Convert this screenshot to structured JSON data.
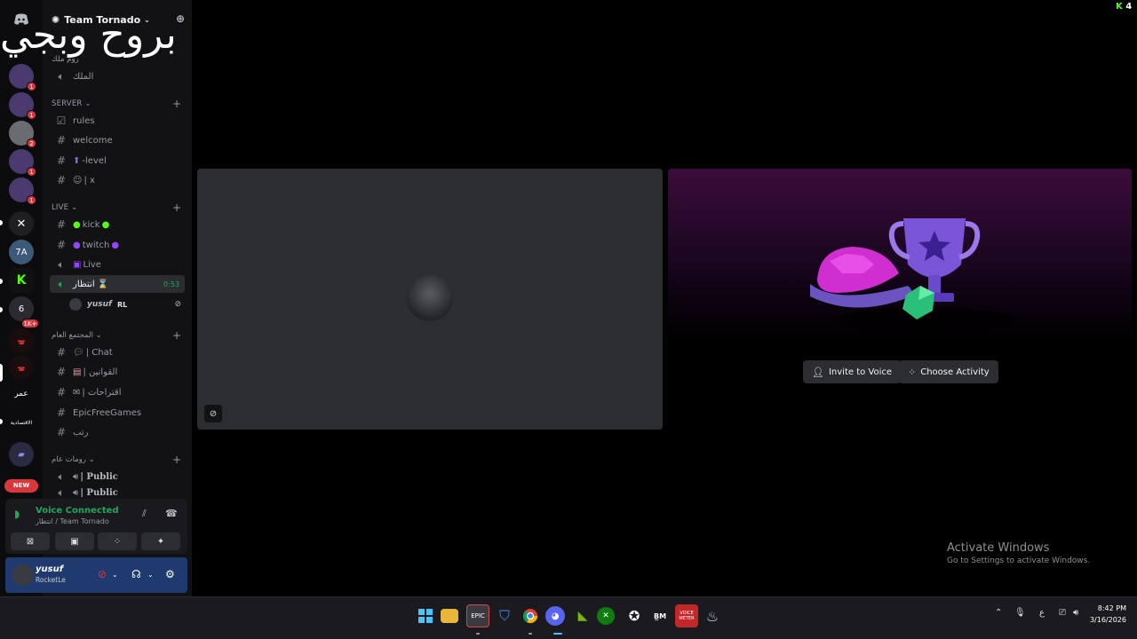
{
  "overlay_text": "بروح وبجي",
  "server": {
    "name": "Team Tornado"
  },
  "rail": {
    "badges": [
      "1",
      "1",
      "2",
      "1",
      "1"
    ],
    "counter_1k": "1K+",
    "counter_6": "6",
    "label_omar": "عمر",
    "label_small": "الاقتصادية",
    "new_badge": "NEW"
  },
  "categories": {
    "top_voice": "روم ملك",
    "server": "SERVER",
    "live": "LIVE",
    "community": "المجتمع العام",
    "public_rooms": "رومات عام"
  },
  "channels": {
    "king": "الملك",
    "rules": "rules",
    "welcome": "welcome",
    "level": "-level",
    "x": "| x",
    "kick": "kick",
    "twitch": "twitch",
    "live": "Live",
    "waiting": "انتظار",
    "waiting_timer": "0:53",
    "chat": "| Chat",
    "laws": "| القوانين",
    "suggestions": "| اقتراحات",
    "epic": "EpicFreeGames",
    "rank": "رتب",
    "public1": "| Public",
    "public2": "| Public"
  },
  "member": {
    "name": "yusuf",
    "tag": "RL"
  },
  "voice_panel": {
    "title": "Voice Connected",
    "subtitle": "انتظار / Team Tornado"
  },
  "user_panel": {
    "name": "yusuf",
    "status": "RocketLe"
  },
  "activity": {
    "invite": "Invite to Voice",
    "choose": "Choose Activity"
  },
  "activate_windows": {
    "line1": "Activate Windows",
    "line2": "Go to Settings to activate Windows."
  },
  "taskbar": {
    "tray_lang": "ع",
    "time": "8:42 PM",
    "date": "3/16/2026",
    "voice_label": "VOICE\nMETER",
    "notif": "4"
  },
  "colors": {
    "voice_green": "#23a55a",
    "badge_red": "#da373c",
    "kick_green": "#53fc18",
    "user_panel": "#1e3a6e"
  }
}
